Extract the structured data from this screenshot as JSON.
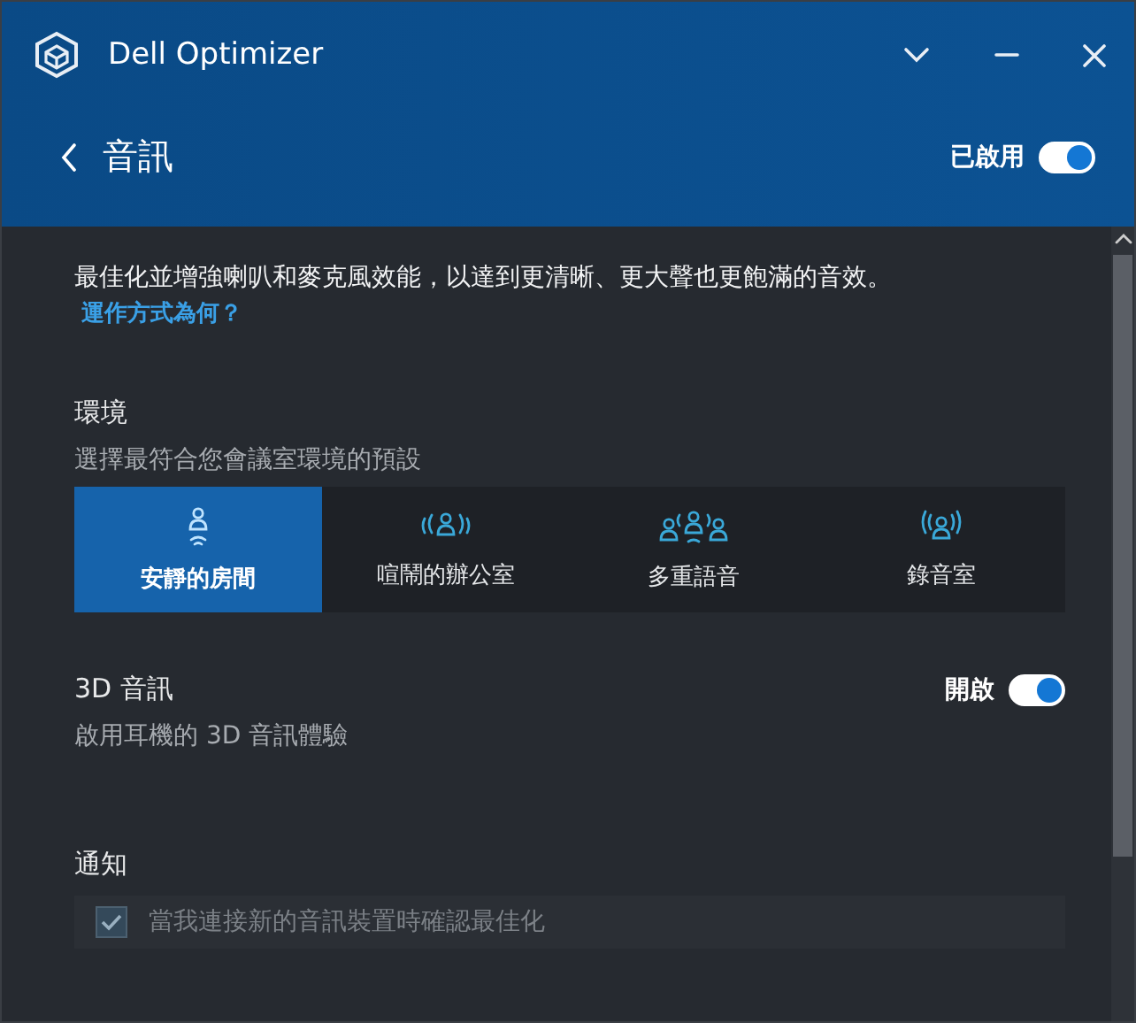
{
  "window": {
    "title": "Dell Optimizer"
  },
  "header": {
    "title": "音訊",
    "toggle": {
      "label": "已啟用",
      "on": true
    }
  },
  "description": "最佳化並增強喇叭和麥克風效能，以達到更清晰、更大聲也更飽滿的音效。",
  "help_link": "運作方式為何？",
  "environment": {
    "title": "環境",
    "subtitle": "選擇最符合您會議室環境的預設",
    "presets": [
      {
        "label": "安靜的房間",
        "kind": "quiet",
        "selected": true
      },
      {
        "label": "喧鬧的辦公室",
        "kind": "noisy",
        "selected": false
      },
      {
        "label": "多重語音",
        "kind": "multi",
        "selected": false
      },
      {
        "label": "錄音室",
        "kind": "studio",
        "selected": false
      }
    ]
  },
  "audio_3d": {
    "title": "3D 音訊",
    "subtitle": "啟用耳機的 3D 音訊體驗",
    "toggle": {
      "label": "開啟",
      "on": true
    }
  },
  "notifications": {
    "title": "通知",
    "option": {
      "label": "當我連接新的音訊裝置時確認最佳化",
      "checked": true,
      "disabled": true
    }
  }
}
